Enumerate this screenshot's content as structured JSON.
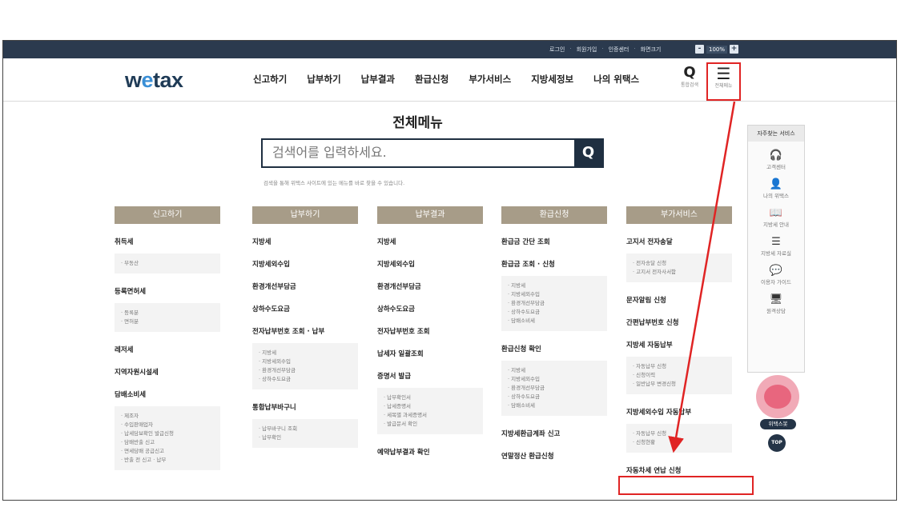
{
  "util_bar": {
    "links": [
      "로그인",
      "회원가입",
      "인증센터",
      "화면크기"
    ],
    "zoom_minus": "-",
    "zoom_value": "100%",
    "zoom_plus": "+"
  },
  "header": {
    "logo": "wetax",
    "nav": [
      "신고하기",
      "납부하기",
      "납부결과",
      "환급신청",
      "부가서비스",
      "지방세정보",
      "나의 위택스"
    ],
    "search_label": "통합검색",
    "menu_label": "전체메뉴"
  },
  "main": {
    "title": "전체메뉴",
    "search_placeholder": "검색어를 입력하세요.",
    "search_hint": "검색을 통해 위택스 사이트에 있는 메뉴를 바로 찾을 수 있습니다."
  },
  "columns": [
    {
      "header": "신고하기",
      "groups": [
        {
          "title": "취득세",
          "subs": [
            "· 부동산"
          ]
        },
        {
          "title": "등록면허세",
          "subs": [
            "· 등록분",
            "· 면허분"
          ]
        },
        {
          "title": "레저세",
          "subs": []
        },
        {
          "title": "지역자원시설세",
          "subs": []
        },
        {
          "title": "담배소비세",
          "subs": [
            "· 제조자",
            "· 수입판매업자",
            "· 납세담보확인 발급신청",
            "· 담배반출 신고",
            "· 면세담배 공급신고",
            "· 반출 전 신고 · 납부"
          ]
        }
      ]
    },
    {
      "header": "납부하기",
      "groups": [
        {
          "title": "지방세",
          "subs": []
        },
        {
          "title": "지방세외수입",
          "subs": []
        },
        {
          "title": "환경개선부담금",
          "subs": []
        },
        {
          "title": "상하수도요금",
          "subs": []
        },
        {
          "title": "전자납부번호 조회 · 납부",
          "subs": [
            "· 지방세",
            "· 지방세외수입",
            "· 환경개선부담금",
            "· 상하수도요금"
          ]
        },
        {
          "title": "통합납부바구니",
          "subs": [
            "· 납부바구니 조회",
            "· 납부확인"
          ]
        }
      ]
    },
    {
      "header": "납부결과",
      "groups": [
        {
          "title": "지방세",
          "subs": []
        },
        {
          "title": "지방세외수입",
          "subs": []
        },
        {
          "title": "환경개선부담금",
          "subs": []
        },
        {
          "title": "상하수도요금",
          "subs": []
        },
        {
          "title": "전자납부번호 조회",
          "subs": []
        },
        {
          "title": "납세자 일괄조회",
          "subs": []
        },
        {
          "title": "증명서 발급",
          "subs": [
            "· 납부확인서",
            "· 납세증명서",
            "· 세목별 과세증명서",
            "· 발급문서 확인"
          ]
        },
        {
          "title": "예약납부결과 확인",
          "subs": []
        }
      ]
    },
    {
      "header": "환급신청",
      "groups": [
        {
          "title": "환급금 간단 조회",
          "subs": []
        },
        {
          "title": "환급금 조회 · 신청",
          "subs": [
            "· 지방세",
            "· 지방세외수입",
            "· 환경개선부담금",
            "· 상하수도요금",
            "· 담배소비세"
          ]
        },
        {
          "title": "환급신청 확인",
          "subs": [
            "· 지방세",
            "· 지방세외수입",
            "· 환경개선부담금",
            "· 상하수도요금",
            "· 담배소비세"
          ]
        },
        {
          "title": "지방세환급계좌 신고",
          "subs": []
        },
        {
          "title": "연말정산 환급신청",
          "subs": []
        }
      ]
    },
    {
      "header": "부가서비스",
      "groups": [
        {
          "title": "고지서 전자송달",
          "subs": [
            "· 전자송달 신청",
            "· 고지서 전자사서함"
          ]
        },
        {
          "title": "문자알림 신청",
          "subs": []
        },
        {
          "title": "간편납부번호 신청",
          "subs": []
        },
        {
          "title": "지방세 자동납부",
          "subs": [
            "· 자동납부 신청",
            "· 신청이력",
            "· 일반납부 변경신청"
          ]
        },
        {
          "title": "지방세외수입 자동납부",
          "subs": [
            "· 자동납부 신청",
            "· 신청현황"
          ]
        },
        {
          "title": "자동차세 연납 신청",
          "subs": []
        }
      ]
    }
  ],
  "quick_panel": {
    "title": "자주찾는 서비스",
    "items": [
      {
        "icon": "headset-icon",
        "glyph": "🎧",
        "label": "고객센터"
      },
      {
        "icon": "person-icon",
        "glyph": "👤",
        "label": "나의 위택스"
      },
      {
        "icon": "guide-icon",
        "glyph": "📖",
        "label": "지방세 안내"
      },
      {
        "icon": "list-icon",
        "glyph": "☰",
        "label": "지방세 자료실"
      },
      {
        "icon": "chat-icon",
        "glyph": "💬",
        "label": "이용자 가이드"
      },
      {
        "icon": "monitor-icon",
        "glyph": "🖥",
        "label": "원격상담"
      }
    ],
    "bot_label": "위택스봇",
    "top_label": "TOP"
  },
  "colors": {
    "util_bar": "#2b3a4e",
    "column_header": "#a79c88",
    "highlight": "#e02424",
    "search_border": "#1f2f41"
  }
}
